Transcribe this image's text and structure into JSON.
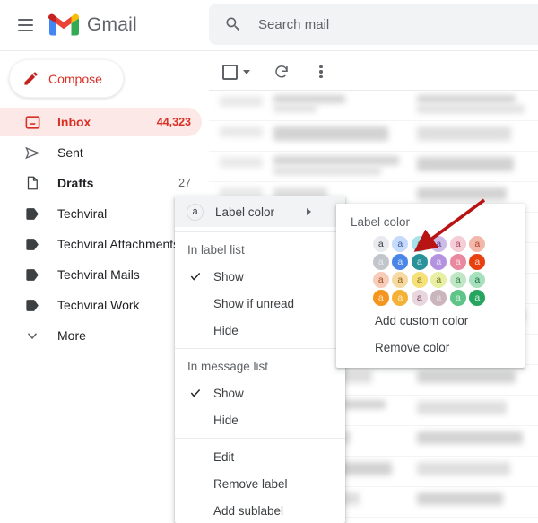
{
  "app": {
    "name": "Gmail",
    "menu_icon": "hamburger-icon",
    "logo_icon": "gmail-logo-icon"
  },
  "search": {
    "placeholder": "Search mail",
    "value": "",
    "icon": "search-icon"
  },
  "compose": {
    "label": "Compose",
    "icon": "pencil-icon"
  },
  "sidebar": {
    "items": [
      {
        "label": "Inbox",
        "count": "44,323",
        "icon": "inbox-icon",
        "active": true,
        "bold": true
      },
      {
        "label": "Sent",
        "count": "",
        "icon": "send-icon",
        "active": false,
        "bold": false
      },
      {
        "label": "Drafts",
        "count": "27",
        "icon": "draft-icon",
        "active": false,
        "bold": true
      },
      {
        "label": "Techviral",
        "count": "",
        "icon": "label-icon",
        "active": false,
        "bold": false
      },
      {
        "label": "Techviral Attachments",
        "count": "",
        "icon": "label-icon",
        "active": false,
        "bold": false
      },
      {
        "label": "Techviral Mails",
        "count": "",
        "icon": "label-icon",
        "active": false,
        "bold": false
      },
      {
        "label": "Techviral Work",
        "count": "",
        "icon": "label-icon",
        "active": false,
        "bold": false
      },
      {
        "label": "More",
        "count": "",
        "icon": "chevron-down-icon",
        "active": false,
        "bold": false
      }
    ]
  },
  "mail_toolbar": {
    "select_all_checkbox": "checkbox-icon",
    "select_caret": "chevron-down-icon",
    "refresh": "refresh-icon",
    "more": "more-vertical-icon"
  },
  "context_menu": {
    "header": {
      "chip": "a",
      "label": "Label color",
      "submenu_arrow": "chevron-right-icon"
    },
    "sections": [
      {
        "title": "In label list",
        "options": [
          {
            "label": "Show",
            "checked": true
          },
          {
            "label": "Show if unread",
            "checked": false
          },
          {
            "label": "Hide",
            "checked": false
          }
        ]
      },
      {
        "title": "In message list",
        "options": [
          {
            "label": "Show",
            "checked": true
          },
          {
            "label": "Hide",
            "checked": false
          }
        ]
      },
      {
        "title": "",
        "options": [
          {
            "label": "Edit",
            "checked": false
          },
          {
            "label": "Remove label",
            "checked": false
          },
          {
            "label": "Add sublabel",
            "checked": false
          }
        ]
      }
    ]
  },
  "color_panel": {
    "title": "Label color",
    "swatch_glyph": "a",
    "swatches": [
      {
        "bg": "#e8eaed",
        "fg": "#3c4043"
      },
      {
        "bg": "#c6dafc",
        "fg": "#3c5a9a"
      },
      {
        "bg": "#a7e3e8",
        "fg": "#23787e"
      },
      {
        "bg": "#cdbbe8",
        "fg": "#5c3f8c"
      },
      {
        "bg": "#f4cdd6",
        "fg": "#a3485f"
      },
      {
        "bg": "#f2b9ab",
        "fg": "#b3402a"
      },
      {
        "bg": "#c2c6cc",
        "fg": "#e8eaed"
      },
      {
        "bg": "#4a86e8",
        "fg": "#dbe8fb"
      },
      {
        "bg": "#2a9299",
        "fg": "#d3eef0"
      },
      {
        "bg": "#b392e0",
        "fg": "#e9dff7"
      },
      {
        "bg": "#e9899f",
        "fg": "#fbe2e8"
      },
      {
        "bg": "#e8400f",
        "fg": "#fbd8cd"
      },
      {
        "bg": "#f7ccb8",
        "fg": "#9c4f20"
      },
      {
        "bg": "#f5d9a0",
        "fg": "#8a6116"
      },
      {
        "bg": "#f5e07a",
        "fg": "#7b6c11"
      },
      {
        "bg": "#e8efa5",
        "fg": "#6a7517"
      },
      {
        "bg": "#bfe7c6",
        "fg": "#2c7a46"
      },
      {
        "bg": "#a6e0bd",
        "fg": "#1f6f47"
      },
      {
        "bg": "#f5951e",
        "fg": "#fde7c8"
      },
      {
        "bg": "#f5b135",
        "fg": "#fdefd2"
      },
      {
        "bg": "#e8d5dd",
        "fg": "#6f4052"
      },
      {
        "bg": "#cbb5bd",
        "fg": "#e8dde2"
      },
      {
        "bg": "#5ec487",
        "fg": "#dff3e7"
      },
      {
        "bg": "#25a55f",
        "fg": "#d7f0e2"
      }
    ],
    "highlighted_index": 2,
    "actions": [
      {
        "label": "Add custom color"
      },
      {
        "label": "Remove color"
      }
    ]
  },
  "annotation": {
    "arrow_color": "#b81414",
    "arrow_target": "third-swatch-row-1"
  },
  "mail_list": {
    "rows_blurred": true,
    "row_count": 14
  }
}
